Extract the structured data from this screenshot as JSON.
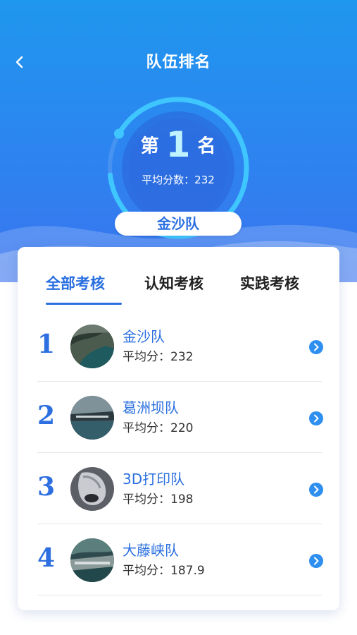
{
  "header": {
    "title": "队伍排名",
    "back_icon": "chevron-left-icon"
  },
  "summary": {
    "rank_prefix": "第",
    "rank_number": "1",
    "rank_suffix": "名",
    "average_text": "平均分数：232",
    "team_name": "金沙队",
    "progress_fraction": 0.9
  },
  "tabs": [
    {
      "label": "全部考核",
      "active": true
    },
    {
      "label": "认知考核",
      "active": false
    },
    {
      "label": "实践考核",
      "active": false
    }
  ],
  "teams": [
    {
      "rank": "1",
      "name": "金沙队",
      "avg": "平均分：232"
    },
    {
      "rank": "2",
      "name": "葛洲坝队",
      "avg": "平均分：220"
    },
    {
      "rank": "3",
      "name": "3D打印队",
      "avg": "平均分：198"
    },
    {
      "rank": "4",
      "name": "大藤峡队",
      "avg": "平均分：187.9"
    }
  ],
  "colors": {
    "accent": "#2a6fe0",
    "header_top": "#1f97ee",
    "header_bottom": "#3a74ee",
    "ring": "#3fc6ff"
  }
}
